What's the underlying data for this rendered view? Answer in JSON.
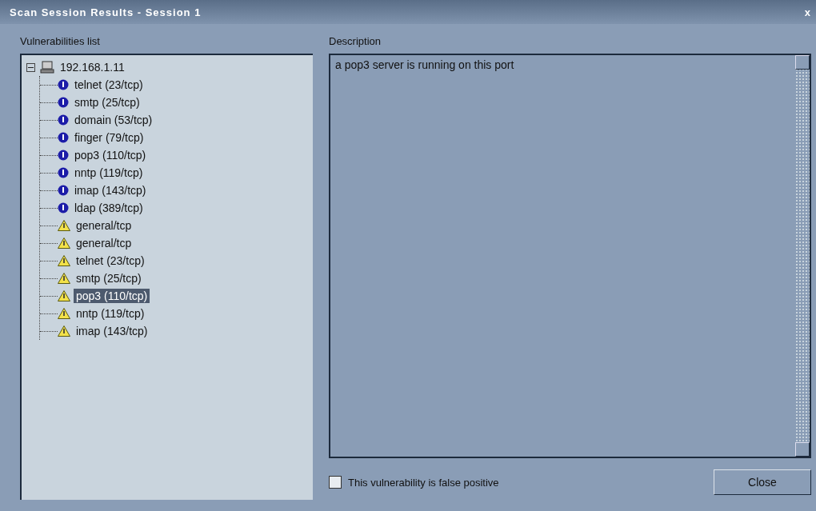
{
  "window": {
    "title": "Scan Session Results - Session 1",
    "close": "x"
  },
  "vulnerabilities": {
    "label": "Vulnerabilities list",
    "root": {
      "label": "192.168.1.11",
      "expanded": true,
      "children": [
        {
          "label": "telnet (23/tcp)",
          "kind": "info",
          "selected": false
        },
        {
          "label": "smtp (25/tcp)",
          "kind": "info",
          "selected": false
        },
        {
          "label": "domain (53/tcp)",
          "kind": "info",
          "selected": false
        },
        {
          "label": "finger (79/tcp)",
          "kind": "info",
          "selected": false
        },
        {
          "label": "pop3 (110/tcp)",
          "kind": "info",
          "selected": false
        },
        {
          "label": "nntp (119/tcp)",
          "kind": "info",
          "selected": false
        },
        {
          "label": "imap (143/tcp)",
          "kind": "info",
          "selected": false
        },
        {
          "label": "ldap (389/tcp)",
          "kind": "info",
          "selected": false
        },
        {
          "label": "general/tcp",
          "kind": "warning",
          "selected": false
        },
        {
          "label": "general/tcp",
          "kind": "warning",
          "selected": false
        },
        {
          "label": "telnet (23/tcp)",
          "kind": "warning",
          "selected": false
        },
        {
          "label": "smtp (25/tcp)",
          "kind": "warning",
          "selected": false
        },
        {
          "label": "pop3 (110/tcp)",
          "kind": "warning",
          "selected": true
        },
        {
          "label": "nntp (119/tcp)",
          "kind": "warning",
          "selected": false
        },
        {
          "label": "imap (143/tcp)",
          "kind": "warning",
          "selected": false
        }
      ]
    }
  },
  "description": {
    "label": "Description",
    "text": "a pop3 server is running on this port"
  },
  "false_positive": {
    "label": "This vulnerability is false positive",
    "checked": false
  },
  "buttons": [
    "Close"
  ]
}
